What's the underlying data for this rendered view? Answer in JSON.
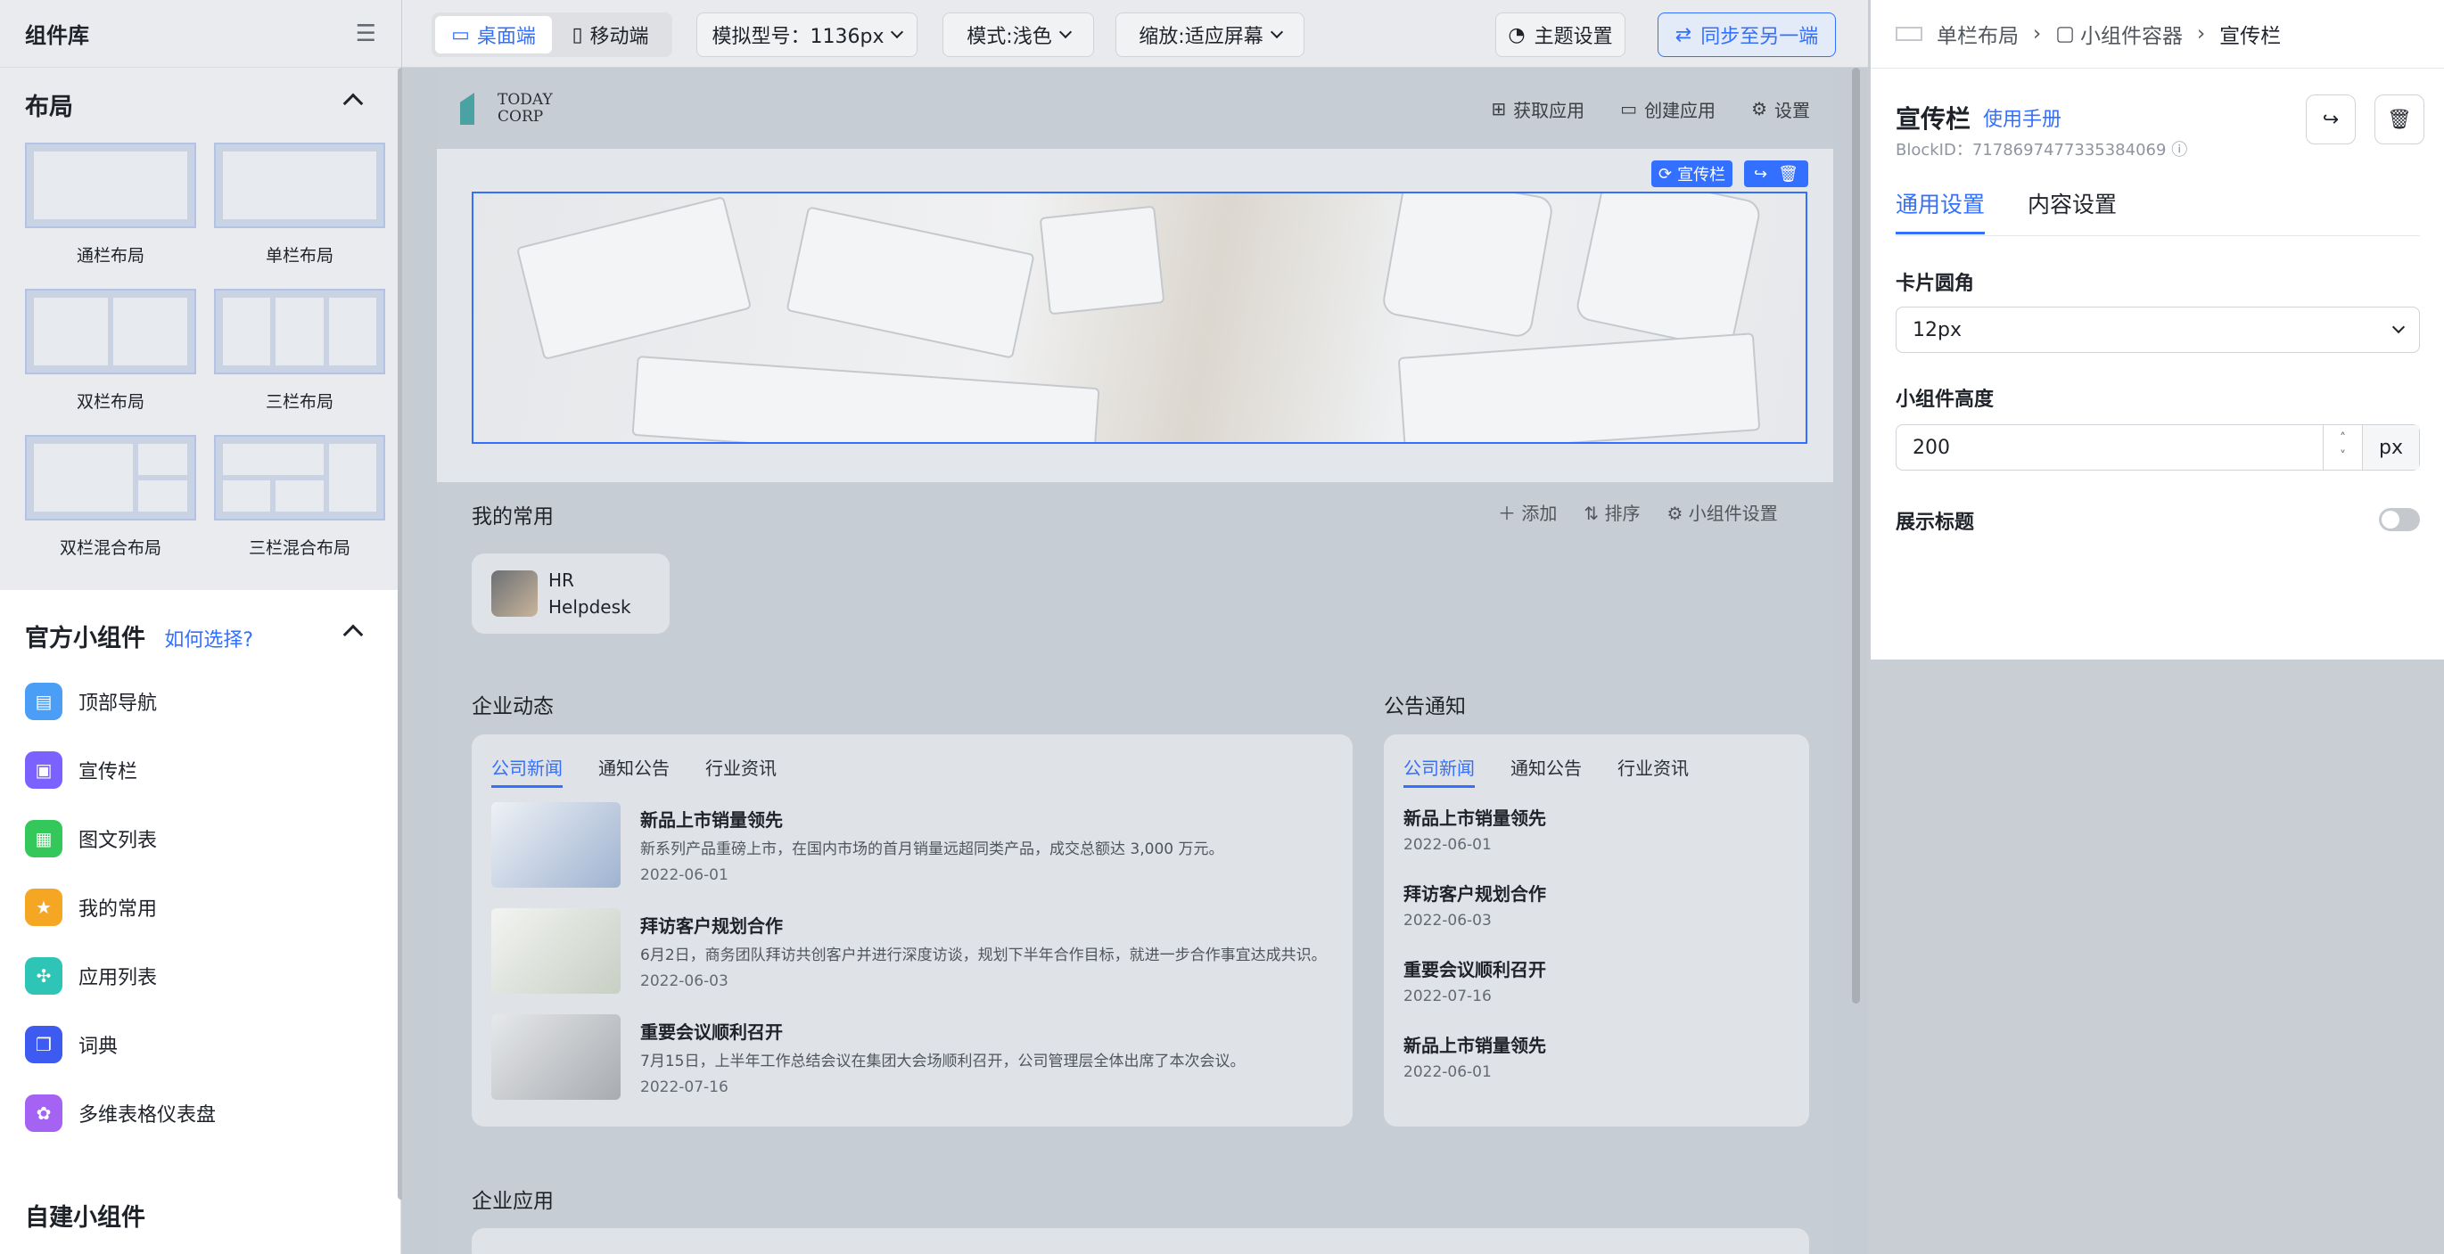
{
  "left": {
    "title": "组件库",
    "layout_section": "布局",
    "layouts": [
      {
        "label": "通栏布局",
        "cols": 1
      },
      {
        "label": "单栏布局",
        "cols": 1
      },
      {
        "label": "双栏布局",
        "cols": 2
      },
      {
        "label": "三栏布局",
        "cols": 3
      },
      {
        "label": "双栏混合布局",
        "cols": 2
      },
      {
        "label": "三栏混合布局",
        "cols": 3
      }
    ],
    "official_section": "官方小组件",
    "how_to_choose": "如何选择?",
    "widgets": [
      {
        "label": "顶部导航",
        "icon": "top-nav-icon",
        "color": "#4b9ef5"
      },
      {
        "label": "宣传栏",
        "icon": "banner-icon",
        "color": "#7b61ff"
      },
      {
        "label": "图文列表",
        "icon": "list-icon",
        "color": "#34c759"
      },
      {
        "label": "我的常用",
        "icon": "star-icon",
        "color": "#f5a623"
      },
      {
        "label": "应用列表",
        "icon": "app-icon",
        "color": "#2ec4b6"
      },
      {
        "label": "词典",
        "icon": "dictionary-icon",
        "color": "#3d5af1"
      },
      {
        "label": "多维表格仪表盘",
        "icon": "dashboard-icon",
        "color": "#a463f2"
      }
    ],
    "custom_section": "自建小组件"
  },
  "toolbar": {
    "desktop": "桌面端",
    "mobile": "移动端",
    "model": "模拟型号：1136px",
    "mode": "模式:浅色",
    "zoom": "缩放:适应屏幕",
    "theme": "主题设置",
    "sync": "同步至另一端"
  },
  "canvas": {
    "logo_line1": "TODAY",
    "logo_line2": "CORP",
    "nav_get_app": "获取应用",
    "nav_create_app": "创建应用",
    "nav_settings": "设置",
    "banner_tag": "宣传栏",
    "favorites_title": "我的常用",
    "fav_add": "添加",
    "fav_sort": "排序",
    "fav_widget_settings": "小组件设置",
    "fav_app_line1": "HR",
    "fav_app_line2": "Helpdesk",
    "news_title": "企业动态",
    "notice_title": "公告通知",
    "news_tabs": [
      "公司新闻",
      "通知公告",
      "行业资讯"
    ],
    "news": [
      {
        "title": "新品上市销量领先",
        "desc": "新系列产品重磅上市，在国内市场的首月销量远超同类产品，成交总额达 3,000 万元。",
        "date": "2022-06-01"
      },
      {
        "title": "拜访客户规划合作",
        "desc": "6月2日，商务团队拜访共创客户并进行深度访谈，规划下半年合作目标，就进一步合作事宜达成共识。",
        "date": "2022-06-03"
      },
      {
        "title": "重要会议顺利召开",
        "desc": "7月15日，上半年工作总结会议在集团大会场顺利召开，公司管理层全体出席了本次会议。",
        "date": "2022-07-16"
      }
    ],
    "notices": [
      {
        "title": "新品上市销量领先",
        "date": "2022-06-01"
      },
      {
        "title": "拜访客户规划合作",
        "date": "2022-06-03"
      },
      {
        "title": "重要会议顺利召开",
        "date": "2022-07-16"
      },
      {
        "title": "新品上市销量领先",
        "date": "2022-06-01"
      }
    ],
    "apps_title": "企业应用"
  },
  "right": {
    "crumb1": "单栏布局",
    "crumb2": "小组件容器",
    "crumb3": "宣传栏",
    "title": "宣传栏",
    "manual": "使用手册",
    "block_id": "BlockID：7178697477335384069",
    "tab_general": "通用设置",
    "tab_content": "内容设置",
    "radius_label": "卡片圆角",
    "radius_value": "12px",
    "height_label": "小组件高度",
    "height_value": "200",
    "height_unit": "px",
    "show_title_label": "展示标题",
    "show_title_on": false
  }
}
